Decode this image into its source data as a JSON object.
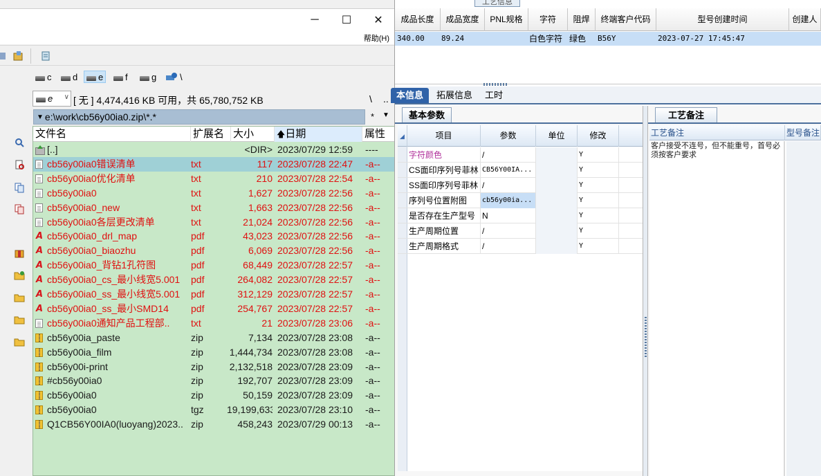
{
  "file_manager": {
    "menu": {
      "help": "帮助(H)"
    },
    "drives": [
      {
        "letter": "c",
        "selected": false
      },
      {
        "letter": "d",
        "selected": false
      },
      {
        "letter": "e",
        "selected": true
      },
      {
        "letter": "f",
        "selected": false
      },
      {
        "letter": "g",
        "selected": false
      },
      {
        "letter": "\\",
        "selected": false
      }
    ],
    "current_drive": "e",
    "space_info": "[ 无 ]  4,474,416 KB 可用，共 65,780,752 KB",
    "path_backslash": "\\",
    "path_dotdot": "..",
    "address": "e:\\work\\cb56y00ia0.zip\\*.*",
    "address_star": "*",
    "columns": {
      "name": "文件名",
      "ext": "扩展名",
      "size": "大小",
      "date": "日期",
      "attr": "属性"
    },
    "files": [
      {
        "icon": "up-dir-icon",
        "name": "[..]",
        "ext": "",
        "size": "<DIR>",
        "date": "2023/07/29 12:59",
        "attr": "----",
        "color": "black"
      },
      {
        "icon": "text-file-icon",
        "name": "cb56y00ia0错误清单",
        "ext": "txt",
        "size": "117",
        "date": "2023/07/28 22:47",
        "attr": "-a--",
        "color": "red",
        "selected": true
      },
      {
        "icon": "text-file-icon",
        "name": "cb56y00ia0优化清单",
        "ext": "txt",
        "size": "210",
        "date": "2023/07/28 22:54",
        "attr": "-a--",
        "color": "red"
      },
      {
        "icon": "text-file-icon",
        "name": "cb56y00ia0",
        "ext": "txt",
        "size": "1,627",
        "date": "2023/07/28 22:56",
        "attr": "-a--",
        "color": "red"
      },
      {
        "icon": "text-file-icon",
        "name": "cb56y00ia0_new",
        "ext": "txt",
        "size": "1,663",
        "date": "2023/07/28 22:56",
        "attr": "-a--",
        "color": "red"
      },
      {
        "icon": "text-file-icon",
        "name": "cb56y00ia0各层更改清单",
        "ext": "txt",
        "size": "21,024",
        "date": "2023/07/28 22:56",
        "attr": "-a--",
        "color": "red"
      },
      {
        "icon": "pdf-file-icon",
        "name": "cb56y00ia0_drl_map",
        "ext": "pdf",
        "size": "43,023",
        "date": "2023/07/28 22:56",
        "attr": "-a--",
        "color": "red"
      },
      {
        "icon": "pdf-file-icon",
        "name": "cb56y00ia0_biaozhu",
        "ext": "pdf",
        "size": "6,069",
        "date": "2023/07/28 22:56",
        "attr": "-a--",
        "color": "red"
      },
      {
        "icon": "pdf-file-icon",
        "name": "cb56y00ia0_背钻1孔符图",
        "ext": "pdf",
        "size": "68,449",
        "date": "2023/07/28 22:57",
        "attr": "-a--",
        "color": "red"
      },
      {
        "icon": "pdf-file-icon",
        "name": "cb56y00ia0_cs_最小线宽5.001",
        "ext": "pdf",
        "size": "264,082",
        "date": "2023/07/28 22:57",
        "attr": "-a--",
        "color": "red"
      },
      {
        "icon": "pdf-file-icon",
        "name": "cb56y00ia0_ss_最小线宽5.001",
        "ext": "pdf",
        "size": "312,129",
        "date": "2023/07/28 22:57",
        "attr": "-a--",
        "color": "red"
      },
      {
        "icon": "pdf-file-icon",
        "name": "cb56y00ia0_ss_最小SMD14",
        "ext": "pdf",
        "size": "254,767",
        "date": "2023/07/28 22:57",
        "attr": "-a--",
        "color": "red"
      },
      {
        "icon": "text-file-icon",
        "name": "cb56y00ia0通知产品工程部..",
        "ext": "txt",
        "size": "21",
        "date": "2023/07/28 23:06",
        "attr": "-a--",
        "color": "red"
      },
      {
        "icon": "zip-file-icon",
        "name": "cb56y00ia_paste",
        "ext": "zip",
        "size": "7,134",
        "date": "2023/07/28 23:08",
        "attr": "-a--",
        "color": "black"
      },
      {
        "icon": "zip-file-icon",
        "name": "cb56y00ia_film",
        "ext": "zip",
        "size": "1,444,734",
        "date": "2023/07/28 23:08",
        "attr": "-a--",
        "color": "black"
      },
      {
        "icon": "zip-file-icon",
        "name": "cb56y00i-print",
        "ext": "zip",
        "size": "2,132,518",
        "date": "2023/07/28 23:09",
        "attr": "-a--",
        "color": "black"
      },
      {
        "icon": "zip-file-icon",
        "name": "#cb56y00ia0",
        "ext": "zip",
        "size": "192,707",
        "date": "2023/07/28 23:09",
        "attr": "-a--",
        "color": "black"
      },
      {
        "icon": "zip-file-icon",
        "name": "cb56y00ia0",
        "ext": "zip",
        "size": "50,159",
        "date": "2023/07/28 23:09",
        "attr": "-a--",
        "color": "black"
      },
      {
        "icon": "zip-file-icon",
        "name": "cb56y00ia0",
        "ext": "tgz",
        "size": "19,199,633",
        "date": "2023/07/28 23:10",
        "attr": "-a--",
        "color": "black"
      },
      {
        "icon": "zip-file-icon",
        "name": "Q1CB56Y00IA0(luoyang)2023..",
        "ext": "zip",
        "size": "458,243",
        "date": "2023/07/29 00:13",
        "attr": "-a--",
        "color": "black"
      }
    ]
  },
  "erp": {
    "top_tab": "工艺信息",
    "grid": {
      "headers": [
        "成品长度",
        "成品宽度",
        "PNL规格",
        "字符",
        "阻焊",
        "终端客户代码",
        "型号创建时间",
        "创建人"
      ],
      "row": [
        "340.00",
        "89.24",
        "",
        "白色字符",
        "绿色",
        "B56Y",
        "2023-07-27 17:45:47",
        ""
      ]
    },
    "tabs": [
      {
        "label": "本信息",
        "active": true
      },
      {
        "label": "拓展信息",
        "active": false
      },
      {
        "label": "工时",
        "active": false
      }
    ],
    "params": {
      "tab_label": "基本参数",
      "headers": [
        "项目",
        "参数",
        "单位",
        "修改"
      ],
      "rows": [
        {
          "item": "字符颜色",
          "value": "/",
          "unit": "",
          "modify": "Y",
          "item_color": "#b0309a"
        },
        {
          "item": "CS面印序列号菲林",
          "value": "CB56Y00IA...",
          "unit": "",
          "modify": "Y"
        },
        {
          "item": "SS面印序列号菲林",
          "value": "/",
          "unit": "",
          "modify": "Y"
        },
        {
          "item": "序列号位置附图",
          "value": "cb56y00ia...",
          "unit": "",
          "modify": "Y",
          "highlight": true
        },
        {
          "item": "是否存在生产型号",
          "value": "N",
          "unit": "",
          "modify": "Y"
        },
        {
          "item": "生产周期位置",
          "value": "/",
          "unit": "",
          "modify": "Y"
        },
        {
          "item": "生产周期格式",
          "value": "/",
          "unit": "",
          "modify": "Y"
        }
      ]
    },
    "notes": {
      "tab_label": "工艺备注",
      "col1_header": "工艺备注",
      "col2_header": "型号备注",
      "text": "客户接受不连号，但不能重号，首号必须按客户要求"
    }
  }
}
